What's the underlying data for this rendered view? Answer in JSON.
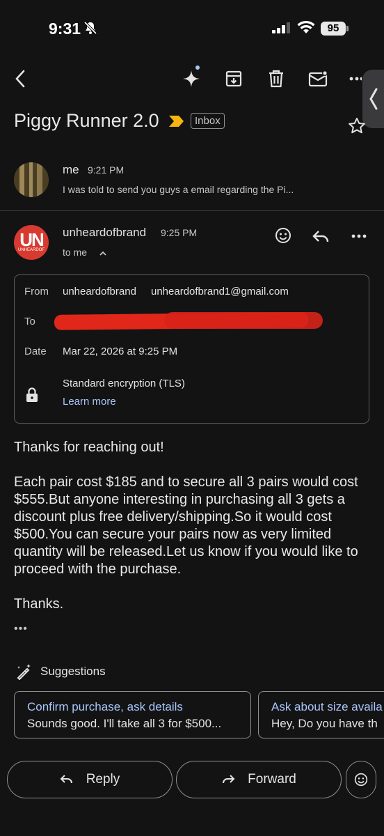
{
  "status_bar": {
    "time": "9:31",
    "battery": "95"
  },
  "subject": {
    "title": "Piggy Runner 2.0",
    "label": "Inbox"
  },
  "message1": {
    "from": "me",
    "time": "9:21 PM",
    "snippet": "I was told to send you guys a email regarding the Pi..."
  },
  "message2": {
    "avatar_text": "UN",
    "avatar_sub": "UNHEARDOF",
    "from": "unheardofbrand",
    "time": "9:25 PM",
    "to_me": "to me"
  },
  "details": {
    "from_label": "From",
    "from_name": "unheardofbrand",
    "from_email": "unheardofbrand1@gmail.com",
    "to_label": "To",
    "date_label": "Date",
    "date_value": "Mar 22, 2026 at 9:25 PM",
    "encryption": "Standard encryption (TLS)",
    "learn_more": "Learn more"
  },
  "body": {
    "p1": "Thanks for reaching out!",
    "p2": "Each pair cost $185 and to secure all 3 pairs would cost $555.But anyone interesting in purchasing all 3 gets a discount plus free delivery/shipping.So it would cost $500.You can secure your pairs now as very limited quantity will be released.Let us know if you would like to proceed with the purchase.",
    "p3": "Thanks.",
    "ellipsis": "•••"
  },
  "suggestions": {
    "heading": "Suggestions",
    "items": [
      {
        "title": "Confirm purchase, ask details",
        "text": "Sounds good. I'll take all 3 for $500..."
      },
      {
        "title": "Ask about size availa",
        "text": "Hey, Do you have th"
      }
    ]
  },
  "actions": {
    "reply": "Reply",
    "forward": "Forward"
  },
  "colors": {
    "background": "#131314",
    "accent_blue": "#a8c7fa",
    "avatar_red": "#d83a2f",
    "redaction": "#e0271a"
  }
}
